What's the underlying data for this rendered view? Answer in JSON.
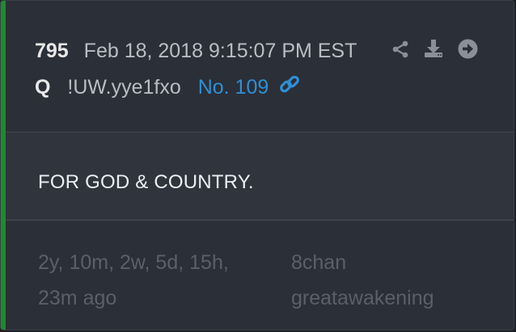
{
  "post": {
    "number": "795",
    "timestamp": "Feb 18, 2018 9:15:07 PM EST",
    "author": "Q",
    "tripcode": "!UW.yye1fxo",
    "post_no": "No. 109",
    "message": "FOR GOD & COUNTRY.",
    "age_line1": "2y, 10m, 2w, 5d, 15h,",
    "age_line2": "23m ago",
    "source_line1": "8chan",
    "source_line2": "greatawakening"
  },
  "icons": {
    "share": "share-icon",
    "download": "download-icon",
    "next": "arrow-right-circle-icon",
    "link": "link-icon"
  },
  "colors": {
    "accent": "#1e8a33",
    "link": "#2f8fd6",
    "card_bg": "#2b2f37"
  }
}
